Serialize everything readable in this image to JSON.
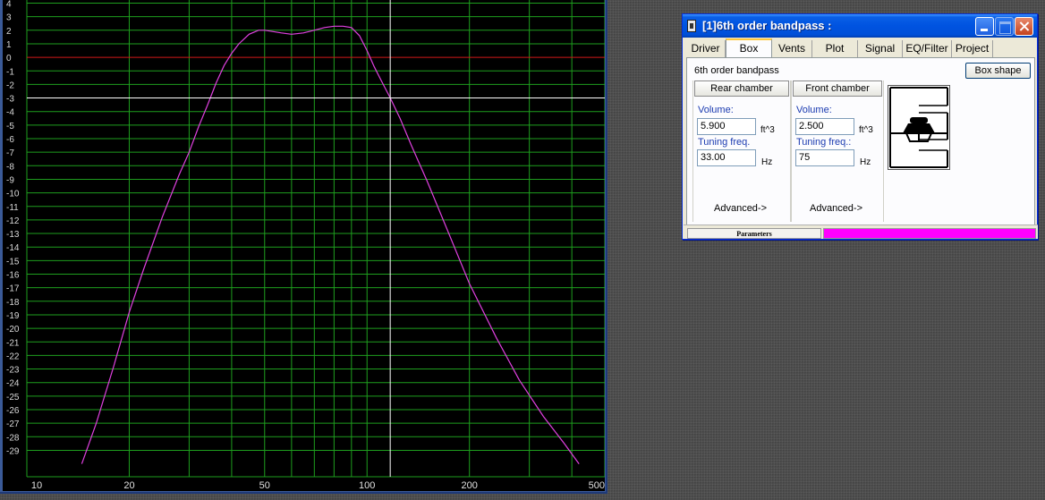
{
  "plot": {
    "y_ticks": [
      "4",
      "3",
      "2",
      "1",
      "0",
      "-1",
      "-2",
      "-3",
      "-4",
      "-5",
      "-6",
      "-7",
      "-8",
      "-9",
      "-10",
      "-11",
      "-12",
      "-13",
      "-14",
      "-15",
      "-16",
      "-17",
      "-18",
      "-19",
      "-20",
      "-21",
      "-22",
      "-23",
      "-24",
      "-25",
      "-26",
      "-27",
      "-28",
      "-29"
    ],
    "x_ticks": [
      {
        "value": 10,
        "label": "10"
      },
      {
        "value": 20,
        "label": "20"
      },
      {
        "value": 50,
        "label": "50"
      },
      {
        "value": 100,
        "label": "100"
      },
      {
        "value": 200,
        "label": "200"
      },
      {
        "value": 500,
        "label": "500"
      }
    ],
    "colors": {
      "background": "#000000",
      "grid": "#1e9e1e",
      "zero_line": "#d01818",
      "curve": "#e040e0",
      "cursor": "#ffffff"
    },
    "cursor": {
      "freq_hz": 117,
      "db": -3
    }
  },
  "chart_data": {
    "type": "line",
    "x_scale": "log",
    "xlim": [
      10,
      500
    ],
    "ylim": [
      -30,
      4.5
    ],
    "series": [
      {
        "x": [
          14.5,
          16,
          18,
          20,
          22,
          25,
          28,
          30,
          32,
          34,
          36,
          38,
          40,
          42,
          45,
          48,
          50,
          53,
          56,
          60,
          65,
          70,
          75,
          80,
          85,
          90,
          95,
          100,
          105,
          110,
          117,
          125,
          135,
          150,
          170,
          200,
          240,
          280,
          330,
          380,
          420
        ],
        "y": [
          -30,
          -27,
          -22.8,
          -18.8,
          -15.7,
          -11.8,
          -8.7,
          -7,
          -5.1,
          -3.5,
          -1.9,
          -0.6,
          0.3,
          1,
          1.7,
          2,
          2,
          1.9,
          1.8,
          1.7,
          1.8,
          2,
          2.2,
          2.3,
          2.3,
          2.2,
          1.6,
          0.5,
          -0.7,
          -1.7,
          -3,
          -4.5,
          -6.5,
          -9.1,
          -12.4,
          -16.7,
          -20.7,
          -23.8,
          -26.5,
          -28.5,
          -30
        ]
      }
    ]
  },
  "dialog": {
    "title": "[1]6th order bandpass :",
    "tabs": [
      "Driver",
      "Box",
      "Vents",
      "Plot",
      "Signal",
      "EQ/Filter",
      "Project"
    ],
    "active_tab": "Box",
    "box_type": "6th order bandpass",
    "box_shape_button": "Box shape",
    "rear": {
      "header": "Rear chamber",
      "volume_label": "Volume:",
      "volume": "5.900",
      "volume_unit": "ft^3",
      "tuning_label": "Tuning freq.",
      "tuning": "33.00",
      "tuning_unit": "Hz",
      "advanced": "Advanced->"
    },
    "front": {
      "header": "Front chamber",
      "volume_label": "Volume:",
      "volume": "2.500",
      "volume_unit": "ft^3",
      "tuning_label": "Tuning freq.:",
      "tuning": "75",
      "tuning_unit": "Hz",
      "advanced": "Advanced->"
    },
    "status": {
      "label": "Parameters",
      "progress": 1.0,
      "bar_color": "#ff00ff"
    }
  }
}
